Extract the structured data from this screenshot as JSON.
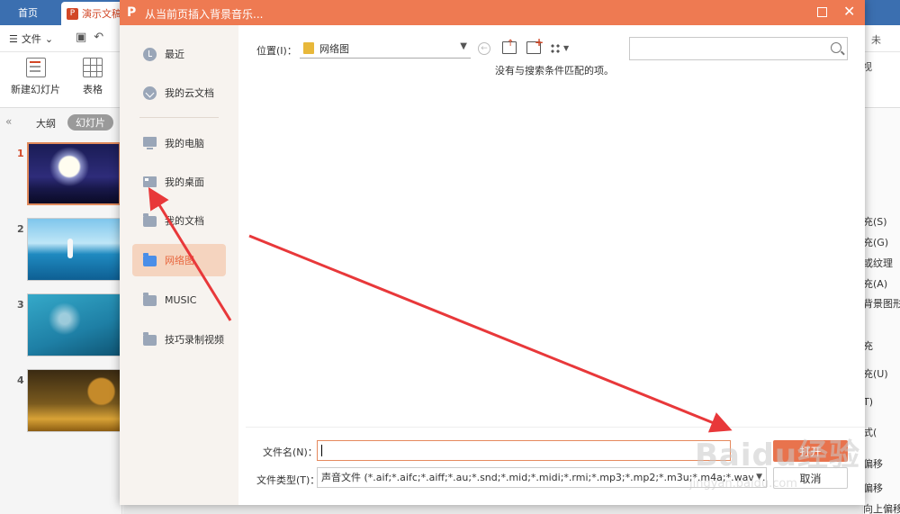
{
  "tabs": {
    "home": "首页",
    "doc": "演示文稿"
  },
  "menu": {
    "file": "文件",
    "right_label": "未"
  },
  "ribbon": {
    "new_slide": "新建幻灯片",
    "table": "表格",
    "right_label": "视"
  },
  "left_panel": {
    "tab_outline": "大纲",
    "tab_slides": "幻灯片",
    "slides": [
      {
        "num": "1"
      },
      {
        "num": "2"
      },
      {
        "num": "3"
      },
      {
        "num": "4"
      }
    ]
  },
  "right_panel": {
    "items": [
      "充(S)",
      "充(G)",
      "或纹理",
      "充(A)",
      "背景图形",
      "充",
      "充(U)",
      "T)",
      "式(",
      "偏移",
      "偏移",
      "向上偏移(O)"
    ]
  },
  "dialog": {
    "title": "从当前页插入背景音乐...",
    "places": [
      {
        "label": "最近",
        "icon": "clock-icon"
      },
      {
        "label": "我的云文档",
        "icon": "cloud-icon"
      },
      {
        "label": "我的电脑",
        "icon": "computer-icon"
      },
      {
        "label": "我的桌面",
        "icon": "desktop-icon"
      },
      {
        "label": "我的文档",
        "icon": "folder-icon"
      },
      {
        "label": "网络图",
        "icon": "folder-icon"
      },
      {
        "label": "MUSIC",
        "icon": "folder-icon"
      },
      {
        "label": "技巧录制视频",
        "icon": "folder-icon"
      }
    ],
    "active_place": "网络图",
    "location_label": "位置(I)：",
    "location_value": "网络图",
    "empty_message": "没有与搜索条件匹配的项。",
    "filename_label": "文件名(N)：",
    "filename_value": "",
    "filetype_label": "文件类型(T)：",
    "filetype_value": "声音文件 (*.aif;*.aifc;*.aiff;*.au;*.snd;*.mid;*.midi;*.rmi;*.mp3;*.mp2;*.m3u;*.m4a;*.wav;*.wma;*.wax)",
    "ok_label": "打开",
    "cancel_label": "取消"
  },
  "watermark": {
    "text": "Baidu经验",
    "sub": "jingyan.baidu.com"
  },
  "colors": {
    "accent": "#ee7a52",
    "active_bg": "#f5d4bf",
    "arrow": "#e8383a",
    "tabbar": "#3b6fb0"
  }
}
